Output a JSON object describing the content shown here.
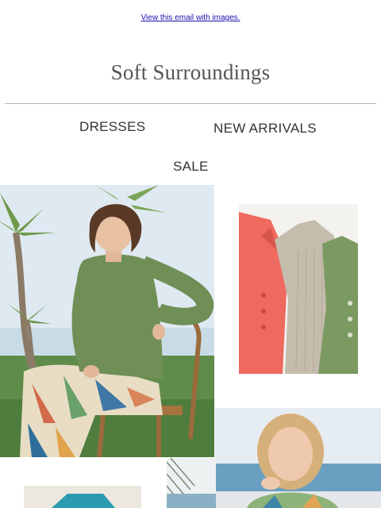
{
  "header": {
    "view_link": "View this email with images.",
    "logo_text": "Soft Surroundings"
  },
  "nav": {
    "dresses": "DRESSES",
    "new_arrivals": "NEW ARRIVALS",
    "sale": "SALE"
  },
  "colors": {
    "link": "#1a0dab",
    "divider": "#b5b5b5",
    "nav_text": "#333333",
    "logo_text": "#555555"
  }
}
